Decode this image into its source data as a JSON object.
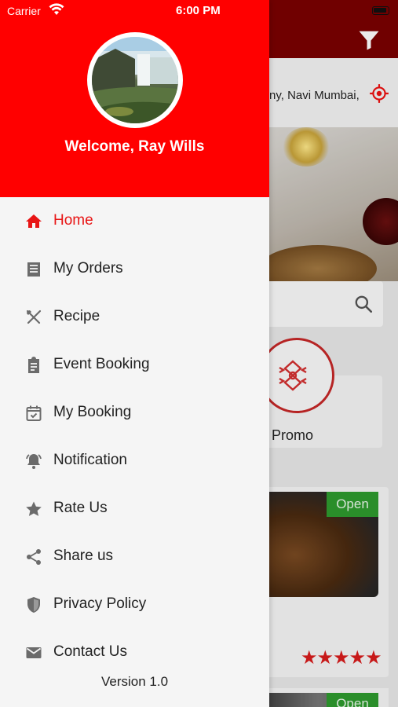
{
  "status_bar": {
    "carrier": "Carrier",
    "time": "6:00 PM"
  },
  "drawer": {
    "welcome": "Welcome, Ray Wills",
    "menu": [
      {
        "label": "Home",
        "icon": "home-icon",
        "active": true
      },
      {
        "label": "My Orders",
        "icon": "orders-icon"
      },
      {
        "label": "Recipe",
        "icon": "utensils-icon"
      },
      {
        "label": "Event Booking",
        "icon": "clipboard-icon"
      },
      {
        "label": "My Booking",
        "icon": "calendar-check-icon"
      },
      {
        "label": "Notification",
        "icon": "bell-icon"
      },
      {
        "label": "Rate Us",
        "icon": "star-icon"
      },
      {
        "label": "Share us",
        "icon": "share-icon"
      },
      {
        "label": "Privacy Policy",
        "icon": "shield-icon"
      },
      {
        "label": "Contact Us",
        "icon": "mail-icon"
      }
    ],
    "version": "Version 1.0"
  },
  "background": {
    "location": "ny, Navi Mumbai,",
    "promo_label": "Promo",
    "open_badge": "Open",
    "open_badge_2": "Open",
    "stars": "★★★★★"
  },
  "colors": {
    "accent": "#ff0000",
    "active_text": "#e81515",
    "open_green": "#2e9b2e"
  }
}
